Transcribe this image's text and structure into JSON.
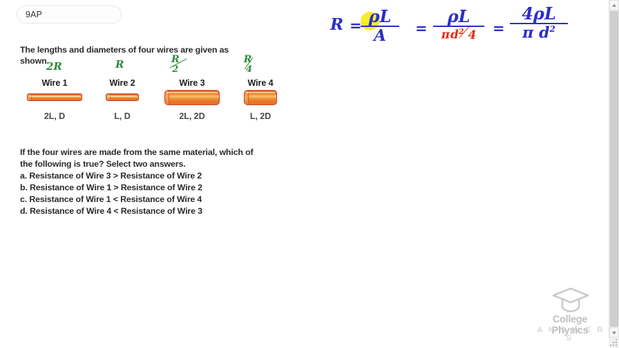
{
  "tag": {
    "label": "9AP"
  },
  "problem": {
    "prompt": "The lengths and diameters of four wires are given as shown.",
    "wires": [
      {
        "name": "Wire 1",
        "spec": "2L, D",
        "annotation": "2R",
        "ann_num": "2R",
        "ann_den": ""
      },
      {
        "name": "Wire 2",
        "spec": "L, D",
        "annotation": "R",
        "ann_num": "R",
        "ann_den": ""
      },
      {
        "name": "Wire 3",
        "spec": "2L, 2D",
        "annotation": "R/2",
        "ann_num": "R",
        "ann_den": "2"
      },
      {
        "name": "Wire 4",
        "spec": "L, 2D",
        "annotation": "R/4",
        "ann_num": "R",
        "ann_den": "4"
      }
    ]
  },
  "question": {
    "stem": "If the four wires are made from the same material, which of the following is true? Select two answers.",
    "choices": [
      "a. Resistance of Wire 3 > Resistance of Wire 2",
      "b. Resistance of Wire 1 > Resistance of Wire 2",
      "c. Resistance of Wire 1 < Resistance of Wire 4",
      "d. Resistance of Wire 4 < Resistance of Wire 3"
    ]
  },
  "equation": {
    "lhs": "R",
    "equals1": "=",
    "frac1_num": "ρL",
    "frac1_den": "A",
    "equals2": "=",
    "frac2_num": "ρL",
    "frac2_den_pi": "π",
    "frac2_den_d": "d",
    "frac2_den_exp": "2",
    "frac2_den_4": "4",
    "equals3": "=",
    "frac3_num": "4ρL",
    "frac3_den_pi": "π",
    "frac3_den_d": "d",
    "frac3_den_exp": "2",
    "highlight_color": "#f6eb1f",
    "blue_ink_color": "#2b2fc4",
    "red_ink_color": "#e02b16",
    "green_ink_color": "#2e8b3a"
  },
  "logo": {
    "line1": "College Physics",
    "line2": "A N S W E R S"
  },
  "scrollbar": {
    "up_label": "▲",
    "down_label": "▼"
  }
}
